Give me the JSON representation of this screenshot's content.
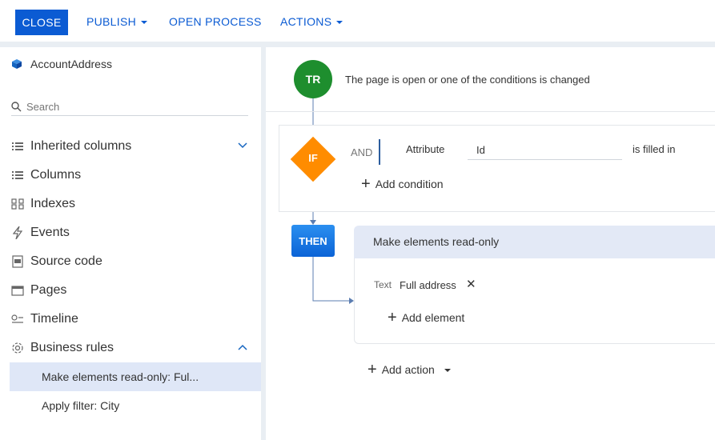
{
  "toolbar": {
    "close_label": "CLOSE",
    "publish_label": "PUBLISH",
    "open_process_label": "OPEN PROCESS",
    "actions_label": "ACTIONS"
  },
  "sidebar": {
    "object_name": "AccountAddress",
    "search_placeholder": "Search",
    "items": [
      {
        "label": "Inherited columns",
        "icon": "list-icon"
      },
      {
        "label": "Columns",
        "icon": "list-icon"
      },
      {
        "label": "Indexes",
        "icon": "index-icon"
      },
      {
        "label": "Events",
        "icon": "lightning-icon"
      },
      {
        "label": "Source code",
        "icon": "code-icon"
      },
      {
        "label": "Pages",
        "icon": "page-icon"
      },
      {
        "label": "Timeline",
        "icon": "timeline-icon"
      },
      {
        "label": "Business rules",
        "icon": "gear-icon"
      }
    ],
    "rules": [
      {
        "label": "Make elements read-only: Ful...",
        "active": true
      },
      {
        "label": "Apply filter: City",
        "active": false
      }
    ]
  },
  "rule": {
    "trigger_badge": "TR",
    "trigger_text": "The page is open or one of the conditions is changed",
    "if_badge": "IF",
    "and_label": "AND",
    "condition": {
      "attribute_label": "Attribute",
      "attribute_value": "Id",
      "operator": "is filled in"
    },
    "add_condition_label": "Add condition",
    "then_badge": "THEN",
    "action_title": "Make elements read-only",
    "element_type": "Text",
    "element_name": "Full address",
    "remove_symbol": "✕",
    "add_element_label": "Add element",
    "add_action_label": "Add action"
  },
  "colors": {
    "primary": "#0b5bd3",
    "trigger_green": "#1e8e2e",
    "if_orange": "#ff8c00",
    "then_blue": "#1a73e8",
    "active_bg": "#dfe7f7"
  }
}
